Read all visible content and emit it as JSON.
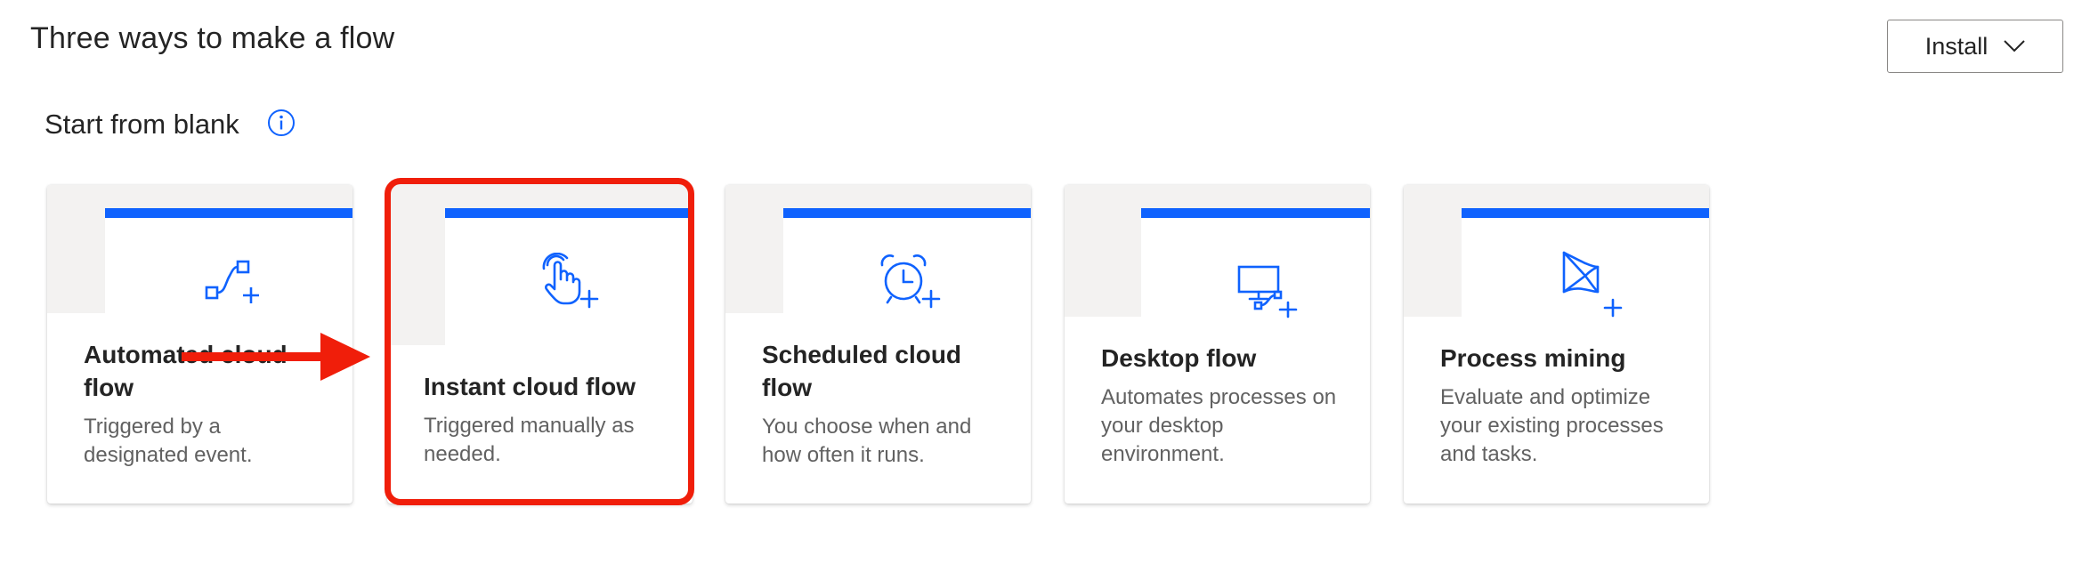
{
  "page": {
    "title": "Three ways to make a flow",
    "install_label": "Install"
  },
  "section": {
    "title": "Start from blank"
  },
  "cards": [
    {
      "title_line1": "Automated cloud",
      "title_line2": "flow",
      "desc_line1": "Triggered by a",
      "desc_line2": "designated event.",
      "desc_line3": "",
      "icon": "automated-flow-icon"
    },
    {
      "title_line1": "Instant cloud flow",
      "title_line2": "",
      "desc_line1": "Triggered manually as",
      "desc_line2": "needed.",
      "desc_line3": "",
      "icon": "instant-flow-icon"
    },
    {
      "title_line1": "Scheduled cloud",
      "title_line2": "flow",
      "desc_line1": "You choose when and",
      "desc_line2": "how often it runs.",
      "desc_line3": "",
      "icon": "scheduled-flow-icon"
    },
    {
      "title_line1": "Desktop flow",
      "title_line2": "",
      "desc_line1": "Automates processes on",
      "desc_line2": "your desktop",
      "desc_line3": "environment.",
      "icon": "desktop-flow-icon"
    },
    {
      "title_line1": "Process mining",
      "title_line2": "",
      "desc_line1": "Evaluate and optimize",
      "desc_line2": "your existing processes",
      "desc_line3": "and tasks.",
      "icon": "process-mining-icon"
    }
  ],
  "colors": {
    "accent_blue": "#0f62fe",
    "annotation_red": "#f01e0a",
    "card_gray": "#f3f2f1"
  }
}
